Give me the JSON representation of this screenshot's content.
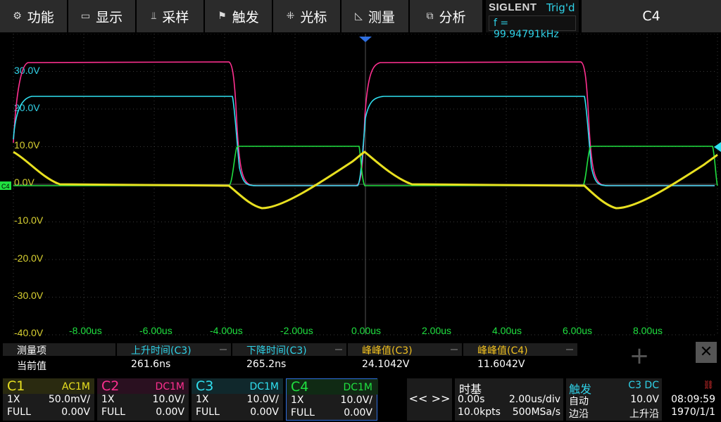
{
  "menu": {
    "items": [
      {
        "label": "功能",
        "icon": "gear-icon"
      },
      {
        "label": "显示",
        "icon": "display-icon"
      },
      {
        "label": "采样",
        "icon": "acquire-icon"
      },
      {
        "label": "触发",
        "icon": "trigger-flag-icon"
      },
      {
        "label": "光标",
        "icon": "cursor-icon"
      },
      {
        "label": "测量",
        "icon": "measure-icon"
      },
      {
        "label": "分析",
        "icon": "analysis-icon"
      }
    ],
    "brand": "SIGLENT",
    "trigger_state": "Trig'd",
    "frequency": "f = 99.94791kHz",
    "active_channel": "C4"
  },
  "scope": {
    "y_labels": [
      "30.0V",
      "20.0V",
      "10.0V",
      "0.0V",
      "-10.0V",
      "-20.0V",
      "-30.0V",
      "-40.0V"
    ],
    "x_labels": [
      "-8.00us",
      "-6.00us",
      "-4.00us",
      "-2.00us",
      "0.00us",
      "2.00us",
      "4.00us",
      "6.00us",
      "8.00us"
    ],
    "ch4_marker": "C4",
    "colors": {
      "C1": "#e8e020",
      "C2": "#ff3090",
      "C3": "#30e0f0",
      "C4": "#20e040",
      "grid": "#3a3a3a"
    }
  },
  "measurements": {
    "header_label": "测量项",
    "value_label": "当前值",
    "items": [
      {
        "name": "上升时间(C3)",
        "value": "261.6ns",
        "color": "#2fd2e8"
      },
      {
        "name": "下降时间(C3)",
        "value": "265.2ns",
        "color": "#2fd2e8"
      },
      {
        "name": "峰峰值(C3)",
        "value": "24.1042V",
        "color": "#f0c020"
      },
      {
        "name": "峰峰值(C4)",
        "value": "11.6042V",
        "color": "#f0c020"
      }
    ],
    "add_symbol": "+",
    "close_symbol": "✕"
  },
  "channels": [
    {
      "name": "C1",
      "coupling": "AC1M",
      "probe": "1X",
      "scale": "50.0mV/",
      "bw": "FULL",
      "offset": "0.00V",
      "color": "#e8e020"
    },
    {
      "name": "C2",
      "coupling": "DC1M",
      "probe": "1X",
      "scale": "10.0V/",
      "bw": "FULL",
      "offset": "0.00V",
      "color": "#ff3090"
    },
    {
      "name": "C3",
      "coupling": "DC1M",
      "probe": "1X",
      "scale": "10.0V/",
      "bw": "FULL",
      "offset": "0.00V",
      "color": "#30e0f0"
    },
    {
      "name": "C4",
      "coupling": "DC1M",
      "probe": "1X",
      "scale": "10.0V/",
      "bw": "FULL",
      "offset": "0.00V",
      "color": "#20e040"
    }
  ],
  "nav": {
    "prev": "<<",
    "next": ">>"
  },
  "timebase": {
    "title": "时基",
    "delay": "0.00s",
    "scale": "2.00us/div",
    "points": "10.0kpts",
    "rate": "500MSa/s"
  },
  "trigger": {
    "title": "触发",
    "source": "C3 DC",
    "mode": "自动",
    "level": "10.0V",
    "type": "边沿",
    "slope": "上升沿"
  },
  "clock": {
    "time": "08:09:59",
    "date": "1970/1/1",
    "icon": "usb-icon"
  }
}
